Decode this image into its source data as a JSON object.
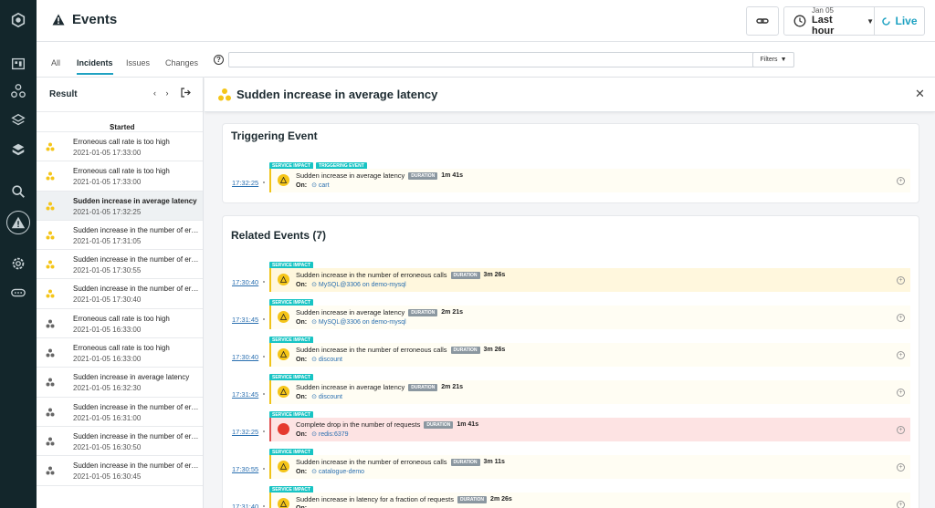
{
  "header": {
    "title": "Events",
    "time_date": "Jan 05",
    "time_range": "Last hour",
    "live_label": "Live"
  },
  "tabs": [
    {
      "label": "All",
      "active": false
    },
    {
      "label": "Incidents",
      "active": true
    },
    {
      "label": "Issues",
      "active": false
    },
    {
      "label": "Changes",
      "active": false
    }
  ],
  "search": {
    "placeholder": "",
    "help": "?",
    "filters_label": "Filters"
  },
  "list": {
    "title": "Result",
    "sort_column": "Started",
    "items": [
      {
        "name": "Erroneous call rate is too high",
        "date": "2021-01-05 17:33:00",
        "icon": "yellow-cluster-icon",
        "selected": false
      },
      {
        "name": "Erroneous call rate is too high",
        "date": "2021-01-05 17:33:00",
        "icon": "yellow-cluster-icon",
        "selected": false
      },
      {
        "name": "Sudden increase in average latency",
        "date": "2021-01-05 17:32:25",
        "icon": "yellow-cluster-icon",
        "selected": true
      },
      {
        "name": "Sudden increase in the number of erroneous calls",
        "date": "2021-01-05 17:31:05",
        "icon": "yellow-cluster-icon",
        "selected": false
      },
      {
        "name": "Sudden increase in the number of erroneous calls",
        "date": "2021-01-05 17:30:55",
        "icon": "yellow-cluster-icon",
        "selected": false
      },
      {
        "name": "Sudden increase in the number of erroneous calls",
        "date": "2021-01-05 17:30:40",
        "icon": "yellow-cluster-icon",
        "selected": false
      },
      {
        "name": "Erroneous call rate is too high",
        "date": "2021-01-05 16:33:00",
        "icon": "gray-cluster-icon",
        "selected": false
      },
      {
        "name": "Erroneous call rate is too high",
        "date": "2021-01-05 16:33:00",
        "icon": "gray-cluster-icon",
        "selected": false
      },
      {
        "name": "Sudden increase in average latency",
        "date": "2021-01-05 16:32:30",
        "icon": "gray-cluster-icon",
        "selected": false
      },
      {
        "name": "Sudden increase in the number of erroneous calls",
        "date": "2021-01-05 16:31:00",
        "icon": "gray-cluster-icon",
        "selected": false
      },
      {
        "name": "Sudden increase in the number of erroneous calls",
        "date": "2021-01-05 16:30:50",
        "icon": "gray-cluster-icon",
        "selected": false
      },
      {
        "name": "Sudden increase in the number of erroneous calls",
        "date": "2021-01-05 16:30:45",
        "icon": "gray-cluster-icon",
        "selected": false
      }
    ]
  },
  "detail": {
    "title": "Sudden increase in average latency",
    "triggering": {
      "heading": "Triggering Event",
      "event": {
        "time": "17:32:25",
        "badges": [
          "SERVICE IMPACT",
          "TRIGGERING EVENT"
        ],
        "title": "Sudden increase in average latency",
        "duration_label": "DURATION",
        "duration": "1m 41s",
        "on_label": "On:",
        "entity": "cart",
        "severity": "warning"
      }
    },
    "related": {
      "heading": "Related Events (7)",
      "events": [
        {
          "time": "17:30:40",
          "badge": "SERVICE IMPACT",
          "title": "Sudden increase in the number of erroneous calls",
          "duration_label": "DURATION",
          "duration": "3m 26s",
          "on_label": "On:",
          "entity": "MySQL@3306 on demo-mysql",
          "severity": "warning"
        },
        {
          "time": "17:31:45",
          "badge": "SERVICE IMPACT",
          "title": "Sudden increase in average latency",
          "duration_label": "DURATION",
          "duration": "2m 21s",
          "on_label": "On:",
          "entity": "MySQL@3306 on demo-mysql",
          "severity": "warning"
        },
        {
          "time": "17:30:40",
          "badge": "SERVICE IMPACT",
          "title": "Sudden increase in the number of erroneous calls",
          "duration_label": "DURATION",
          "duration": "3m 26s",
          "on_label": "On:",
          "entity": "discount",
          "severity": "warning"
        },
        {
          "time": "17:31:45",
          "badge": "SERVICE IMPACT",
          "title": "Sudden increase in average latency",
          "duration_label": "DURATION",
          "duration": "2m 21s",
          "on_label": "On:",
          "entity": "discount",
          "severity": "warning"
        },
        {
          "time": "17:32:25",
          "badge": "SERVICE IMPACT",
          "title": "Complete drop in the number of requests",
          "duration_label": "DURATION",
          "duration": "1m 41s",
          "on_label": "On:",
          "entity": "redis:6379",
          "severity": "critical"
        },
        {
          "time": "17:30:55",
          "badge": "SERVICE IMPACT",
          "title": "Sudden increase in the number of erroneous calls",
          "duration_label": "DURATION",
          "duration": "3m 11s",
          "on_label": "On:",
          "entity": "catalogue-demo",
          "severity": "warning"
        },
        {
          "time": "17:31:40",
          "badge": "SERVICE IMPACT",
          "title": "Sudden increase in latency for a fraction of requests",
          "duration_label": "DURATION",
          "duration": "2m 26s",
          "on_label": "On:",
          "entity": "",
          "severity": "warning"
        }
      ]
    }
  },
  "colors": {
    "accent": "#1fa2c2",
    "rail": "#13262b",
    "badge": "#18c4c4",
    "warning": "#f5c518",
    "critical": "#e53a2f"
  }
}
